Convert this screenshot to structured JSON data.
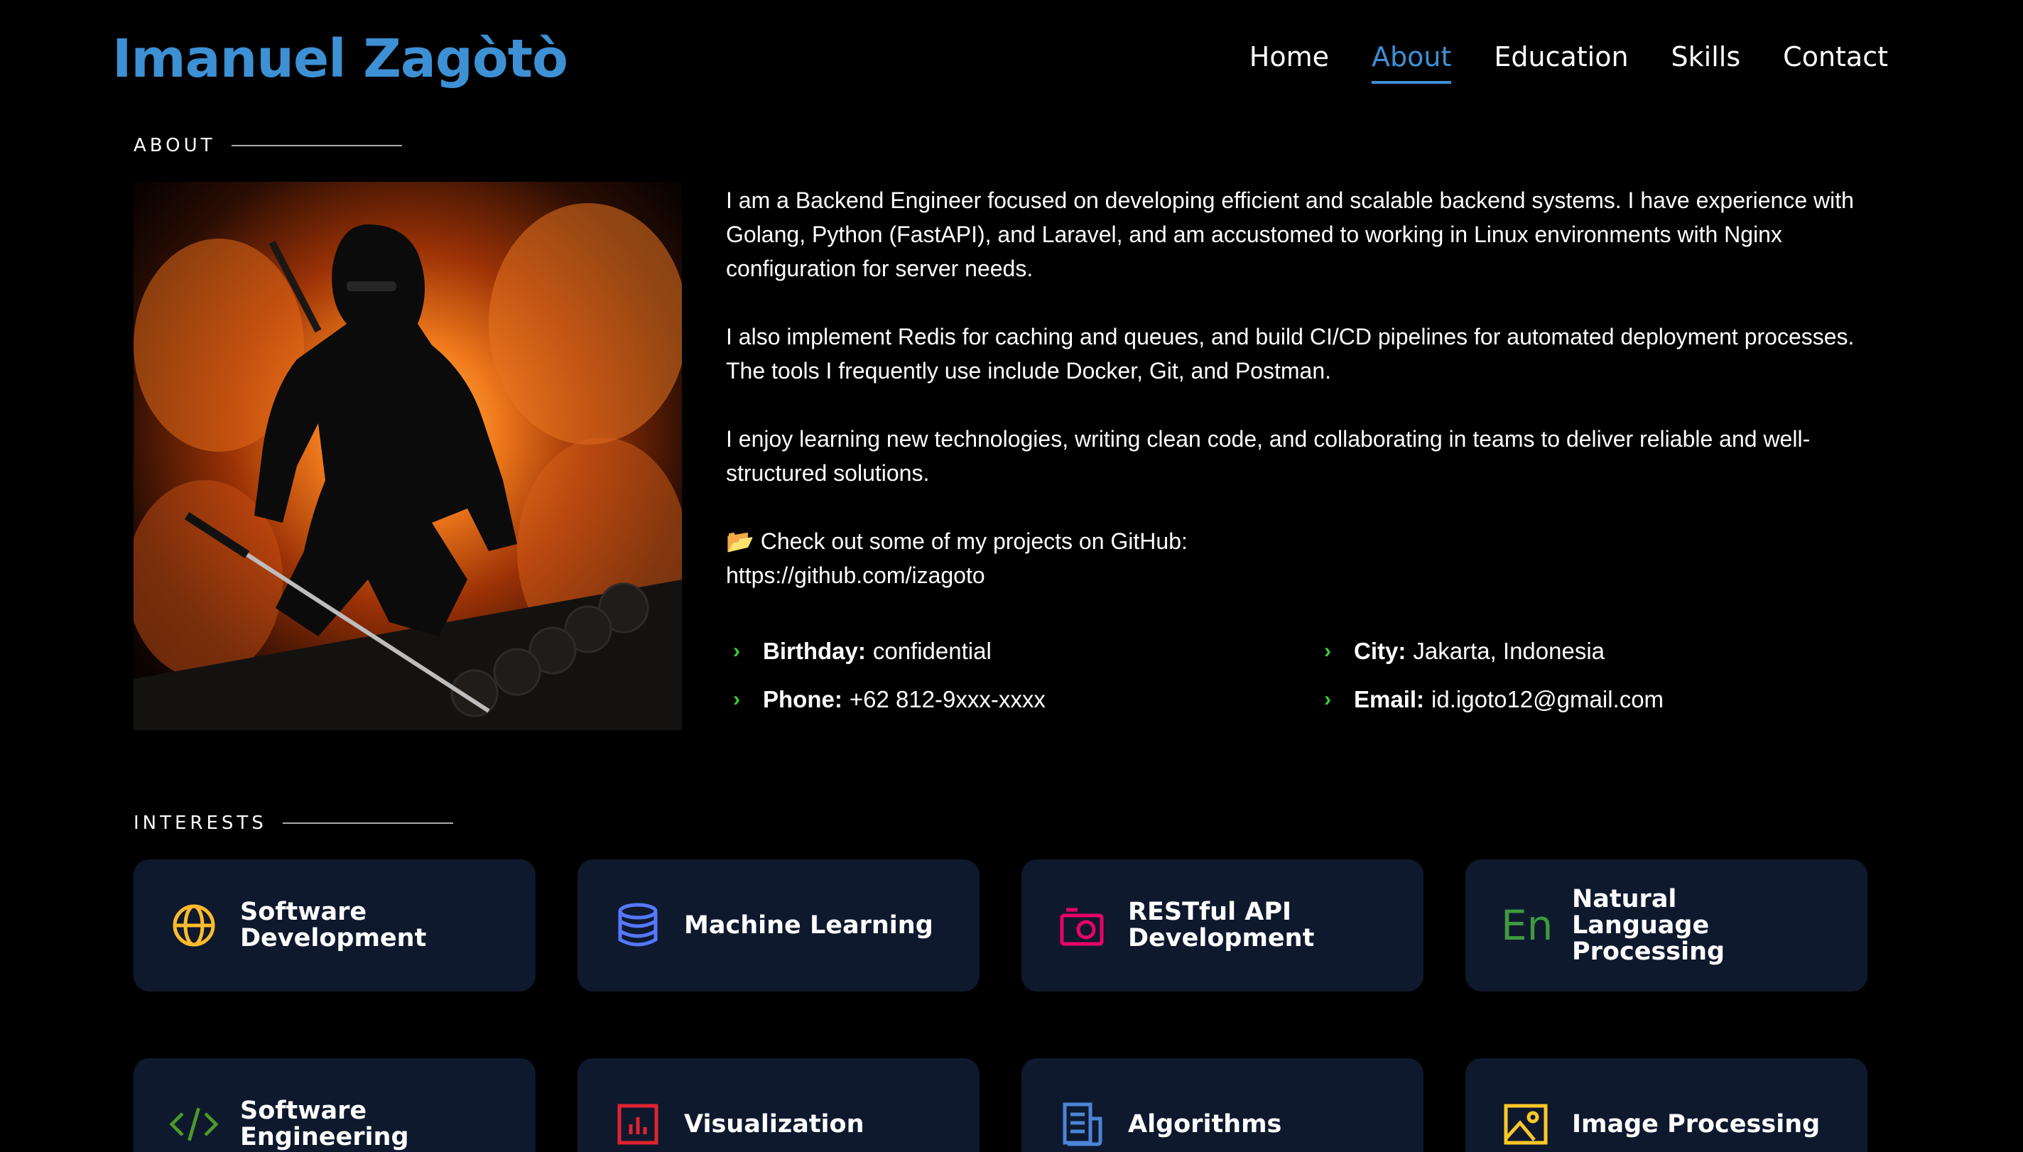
{
  "header": {
    "logo": "Imanuel Zagòtò",
    "nav": [
      {
        "label": "Home",
        "active": false
      },
      {
        "label": "About",
        "active": true
      },
      {
        "label": "Education",
        "active": false
      },
      {
        "label": "Skills",
        "active": false
      },
      {
        "label": "Contact",
        "active": false
      }
    ]
  },
  "about": {
    "section_title": "ABOUT",
    "image_alt": "ninja-portrait",
    "paragraphs": [
      "I am a Backend Engineer focused on developing efficient and scalable backend systems. I have experience with Golang, Python (FastAPI), and Laravel, and am accustomed to working in Linux environments with Nginx configuration for server needs.",
      "I also implement Redis for caching and queues, and build CI/CD pipelines for automated deployment processes. The tools I frequently use include Docker, Git, and Postman.",
      "I enjoy learning new technologies, writing clean code, and collaborating in teams to deliver reliable and well-structured solutions."
    ],
    "github_line": "📂 Check out some of my projects on GitHub:",
    "github_url": "https://github.com/izagoto",
    "info": {
      "birthday_label": "Birthday:",
      "birthday": "confidential",
      "phone_label": "Phone:",
      "phone": "+62 812-9xxx-xxxx",
      "city_label": "City:",
      "city": "Jakarta, Indonesia",
      "email_label": "Email:",
      "email": "id.igoto12@gmail.com"
    }
  },
  "interests": {
    "section_title": "INTERESTS",
    "items": [
      {
        "label": "Software Development",
        "icon": "globe-icon",
        "color": "#ffbb2c"
      },
      {
        "label": "Machine Learning",
        "icon": "database-icon",
        "color": "#5578ff"
      },
      {
        "label": "RESTful API Development",
        "icon": "camera-icon",
        "color": "#e80368"
      },
      {
        "label": "Natural Language Processing",
        "icon": "en-icon",
        "color": "#47aeff"
      },
      {
        "label": "Software Engineering",
        "icon": "code-icon",
        "color": "#4c9a2a"
      },
      {
        "label": "Visualization",
        "icon": "bar-chart-icon",
        "color": "#e0242f"
      },
      {
        "label": "Algorithms",
        "icon": "document-icon",
        "color": "#4c84d6"
      },
      {
        "label": "Image Processing",
        "icon": "image-icon",
        "color": "#ffc829"
      }
    ]
  }
}
